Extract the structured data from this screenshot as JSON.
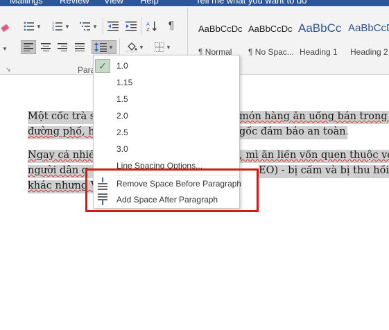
{
  "menubar": {
    "items": [
      "Mailings",
      "Review",
      "View",
      "Help"
    ],
    "tell_me": "Tell me what you want to do"
  },
  "ribbon": {
    "paragraph_group_label": "Para",
    "styles": [
      {
        "sample": "AaBbCcDc",
        "name": "¶ Normal"
      },
      {
        "sample": "AaBbCcDc",
        "name": "¶ No Spac..."
      },
      {
        "sample": "AaBbCс",
        "name": "Heading 1"
      },
      {
        "sample": "AaBbCcD",
        "name": "Heading 2"
      }
    ]
  },
  "line_spacing_menu": {
    "options": [
      "1.0",
      "1.15",
      "1.5",
      "2.0",
      "2.5",
      "3.0"
    ],
    "selected": "1.0",
    "line_spacing_options": "Line Spacing Options...",
    "remove_space_before": "Remove Space Before Paragraph",
    "add_space_after": "Add Space After Paragraph"
  },
  "document": {
    "p1": {
      "line1_left": "Một cốc trà s",
      "line1_right": "món hàng ăn uống bán trong qu",
      "line2_left": "đường phố, h",
      "line2_right": "gốc đảm bảo an toàn."
    },
    "p2": {
      "line1_left": "Ngay cả nhiề",
      "line1_right": ", mì ăn liền vốn quen thuộc với",
      "line2_left": "người dân q",
      "line2_right": "EO) - bị cấm và bị thu hồi ở nh",
      "line3_left": "khác nhưng V"
    }
  },
  "colors": {
    "menubar": "#2b579a",
    "ribbon": "#f3f3f3",
    "highlight_box": "#d11a1a",
    "selection": "#cfcfcf",
    "heading_style": "#2f5597"
  }
}
